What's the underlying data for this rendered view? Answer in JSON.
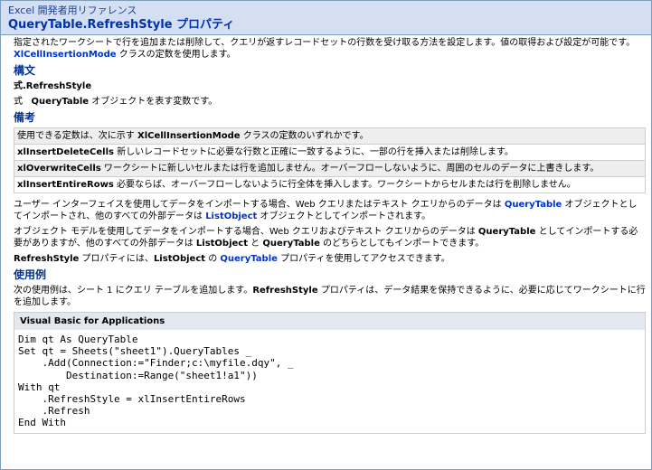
{
  "header": {
    "breadcrumb": "Excel 開発者用リファレンス",
    "title": "QueryTable.RefreshStyle プロパティ"
  },
  "intro": {
    "text1": "指定されたワークシートで行を追加または削除して、クエリが返すレコードセットの行数を受け取る方法を設定します。値の取得および設定が可能です。",
    "link": "XlCellInsertionMode",
    "text2": " クラスの定数を使用します。"
  },
  "syntax": {
    "heading": "構文",
    "expression": "式.RefreshStyle",
    "param_prefix": "式   ",
    "param_name": "QueryTable",
    "param_desc": " オブジェクトを表す変数です。"
  },
  "remarks": {
    "heading": "備考",
    "table_intro_prefix": "使用できる定数は、次に示す ",
    "table_intro_bold": "XlCellInsertionMode",
    "table_intro_suffix": " クラスの定数のいずれかです。",
    "rows": [
      {
        "name": "xlInsertDeleteCells",
        "desc": " 新しいレコードセットに必要な行数と正確に一致するように、一部の行を挿入または削除します。"
      },
      {
        "name": "xlOverwriteCells",
        "desc": " ワークシートに新しいセルまたは行を追加しません。オーバーフローしないように、周囲のセルのデータに上書きします。"
      },
      {
        "name": "xlInsertEntireRows",
        "desc": " 必要ならば、オーバーフローしないように行全体を挿入します。ワークシートからセルまたは行を削除しません。"
      }
    ],
    "p1_a": "ユーザー インターフェイスを使用してデータをインポートする場合、Web クエリまたはテキスト クエリからのデータは ",
    "p1_link1": "QueryTable",
    "p1_b": " オブジェクトとしてインポートされ、他のすべての外部データは ",
    "p1_link2": "ListObject",
    "p1_c": " オブジェクトとしてインポートされます。",
    "p2_a": "オブジェクト モデルを使用してデータをインポートする場合、Web クエリおよびテキスト クエリからのデータは ",
    "p2_b1": "QueryTable",
    "p2_b": " としてインポートする必要がありますが、他のすべての外部データは ",
    "p2_b2": "ListObject",
    "p2_c": " と ",
    "p2_b3": "QueryTable",
    "p2_d": " のどちらとしてもインポートできます。",
    "p3_b1": "RefreshStyle",
    "p3_a": " プロパティには、",
    "p3_b2": "ListObject",
    "p3_b": " の ",
    "p3_link": "QueryTable",
    "p3_c": " プロパティを使用してアクセスできます。"
  },
  "example": {
    "heading": "使用例",
    "text_a": "次の使用例は、シート 1 にクエリ テーブルを追加します。",
    "text_bold": "RefreshStyle",
    "text_b": " プロパティは、データ結果を保持できるように、必要に応じてワークシートに行を追加します。",
    "code_lang": "Visual Basic for Applications",
    "code_lines": [
      "Dim qt As QueryTable",
      "Set qt = Sheets(\"sheet1\").QueryTables _",
      "    .Add(Connection:=\"Finder;c:\\myfile.dqy\", _",
      "        Destination:=Range(\"sheet1!a1\"))",
      "With qt",
      "    .RefreshStyle = xlInsertEntireRows",
      "    .Refresh",
      "End With"
    ]
  }
}
